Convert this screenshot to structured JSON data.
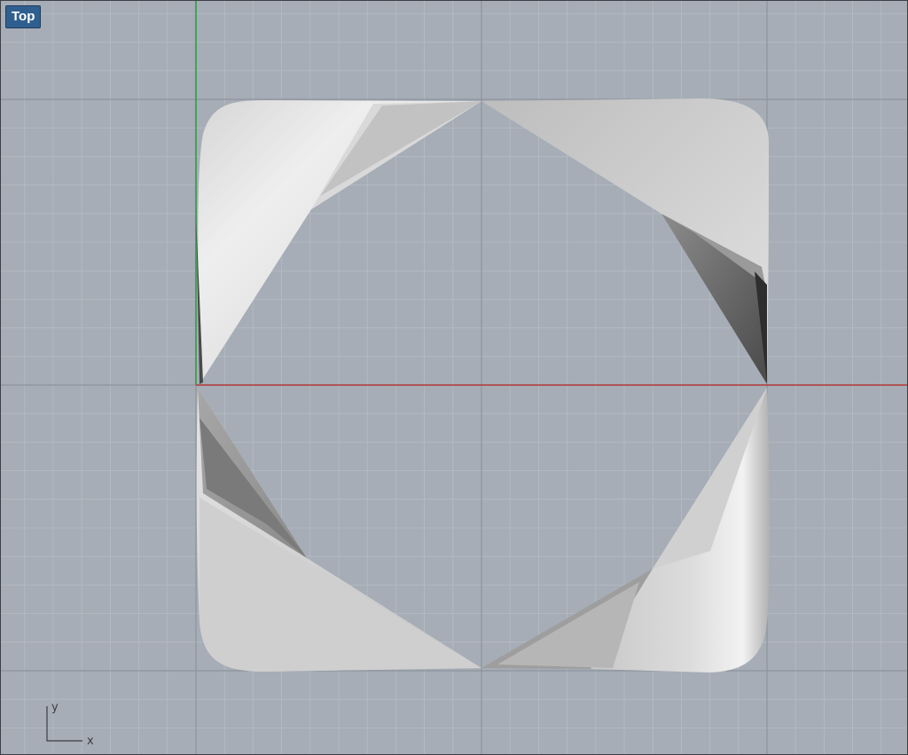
{
  "viewport": {
    "name": "Top"
  },
  "axis_gizmo": {
    "x_label": "x",
    "y_label": "y"
  },
  "colors": {
    "background": "#a6adb6",
    "grid_minor": "#b6bcc4",
    "grid_major": "#8e949c",
    "x_axis": "#b53a3a",
    "y_axis": "#2f9a3d",
    "label_bg": "#2f5f8f",
    "surface_light": "#e6e6e6",
    "surface_mid": "#bdbdbd",
    "surface_dark": "#5a5a5a"
  },
  "model": {
    "description_icon": "ruled-surface-ring",
    "pieces": 4
  }
}
